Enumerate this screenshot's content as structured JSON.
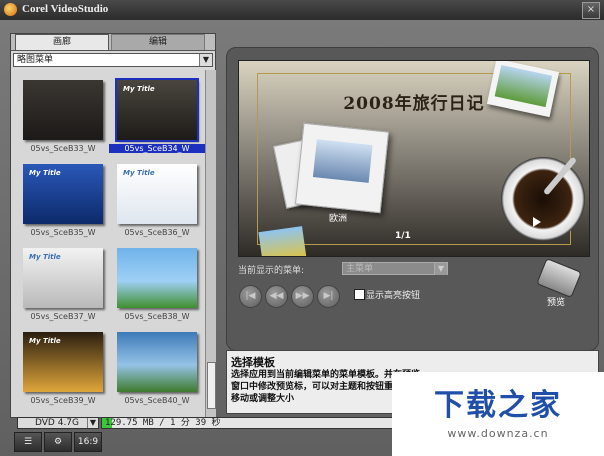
{
  "window": {
    "title": "Corel VideoStudio",
    "close_glyph": "×"
  },
  "library": {
    "tabs": [
      {
        "label": "画廊"
      },
      {
        "label": "编辑"
      }
    ],
    "dropdown": {
      "value": "略图菜单"
    },
    "thumbnails": [
      {
        "label": "05vs_SceB33_W",
        "selected": false,
        "style": "dark-grid"
      },
      {
        "label": "05vs_SceB34_W",
        "selected": true,
        "style": "dark-title"
      },
      {
        "label": "05vs_SceB35_W",
        "selected": false,
        "style": "blue"
      },
      {
        "label": "05vs_SceB36_W",
        "selected": false,
        "style": "light"
      },
      {
        "label": "05vs_SceB37_W",
        "selected": false,
        "style": "gray"
      },
      {
        "label": "05vs_SceB38_W",
        "selected": false,
        "style": "bus"
      },
      {
        "label": "05vs_SceB39_W",
        "selected": false,
        "style": "gold"
      },
      {
        "label": "05vs_SceB40_W",
        "selected": false,
        "style": "landscape"
      }
    ],
    "thumb_title_text": "My Title"
  },
  "preview": {
    "title": "2008年旅行日记",
    "caption": "欧洲",
    "page": "1/1",
    "menu_label": "当前显示的菜单:",
    "menu_value": "主菜单",
    "controls": [
      {
        "glyph": "|◀"
      },
      {
        "glyph": "◀◀"
      },
      {
        "glyph": "▶▶"
      },
      {
        "glyph": "▶|"
      }
    ],
    "highlight_label": "显示高亮按钮",
    "highlight_checked": false,
    "preview_button_label": "预览"
  },
  "description": {
    "title": "选择模板",
    "text": "选择应用到当前编辑菜单的菜单模板。并在预览窗口中修改预览标，可以对主题和按钮重命名、移动或调整大小"
  },
  "status": {
    "disc": "DVD 4.7G",
    "capacity_text": "129.75 MB / 1 分 39 秒",
    "capacity_fraction": 0.03
  },
  "bottom_icons": [
    {
      "name": "settings-list-icon",
      "glyph": "☰"
    },
    {
      "name": "gear-icon",
      "glyph": "⚙"
    },
    {
      "name": "aspect-ratio-icon",
      "glyph": "16:9"
    }
  ],
  "watermark": {
    "main": "下载之家",
    "sub": "www.downza.cn"
  },
  "colors": {
    "selection": "#1c2fbd",
    "capacity_fill": "#3ac83a",
    "watermark": "#1f4fa8"
  }
}
